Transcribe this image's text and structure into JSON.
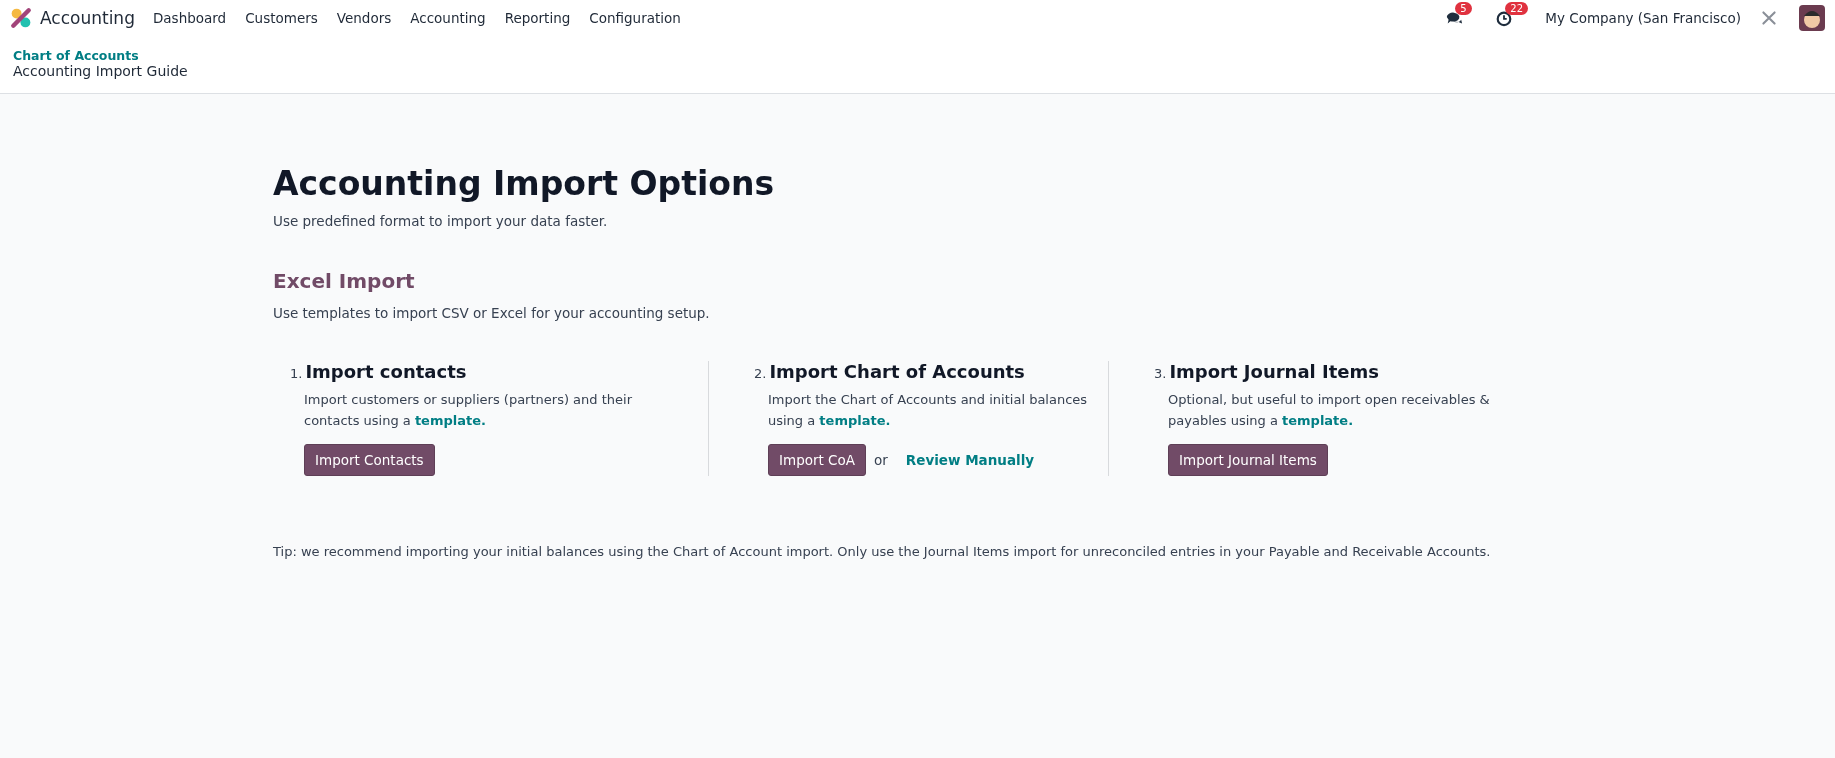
{
  "navbar": {
    "app_name": "Accounting",
    "menu": [
      "Dashboard",
      "Customers",
      "Vendors",
      "Accounting",
      "Reporting",
      "Configuration"
    ],
    "messages_count": "5",
    "activities_count": "22",
    "company": "My Company (San Francisco)"
  },
  "breadcrumb": {
    "parent": "Chart of Accounts",
    "current": "Accounting Import Guide"
  },
  "title": "Accounting Import Options",
  "subtitle": "Use predefined format to import your data faster.",
  "section": {
    "title": "Excel Import",
    "description": "Use templates to import CSV or Excel for your accounting setup."
  },
  "steps": [
    {
      "number": "1.",
      "title": "Import contacts",
      "text": "Import customers or suppliers (partners) and their contacts using a ",
      "link": "template.",
      "button": "Import Contacts"
    },
    {
      "number": "2.",
      "title": "Import Chart of Accounts",
      "text": "Import the Chart of Accounts and initial balances using a ",
      "link": "template.",
      "button": "Import CoA",
      "or": "or",
      "alt_link": "Review Manually"
    },
    {
      "number": "3.",
      "title": "Import Journal Items",
      "text": "Optional, but useful to import open receivables & payables using a ",
      "link": "template.",
      "button": "Import Journal Items"
    }
  ],
  "tip": "Tip: we recommend importing your initial balances using the Chart of Account import. Only use the Journal Items import for unreconciled entries in your Payable and Receivable Accounts."
}
